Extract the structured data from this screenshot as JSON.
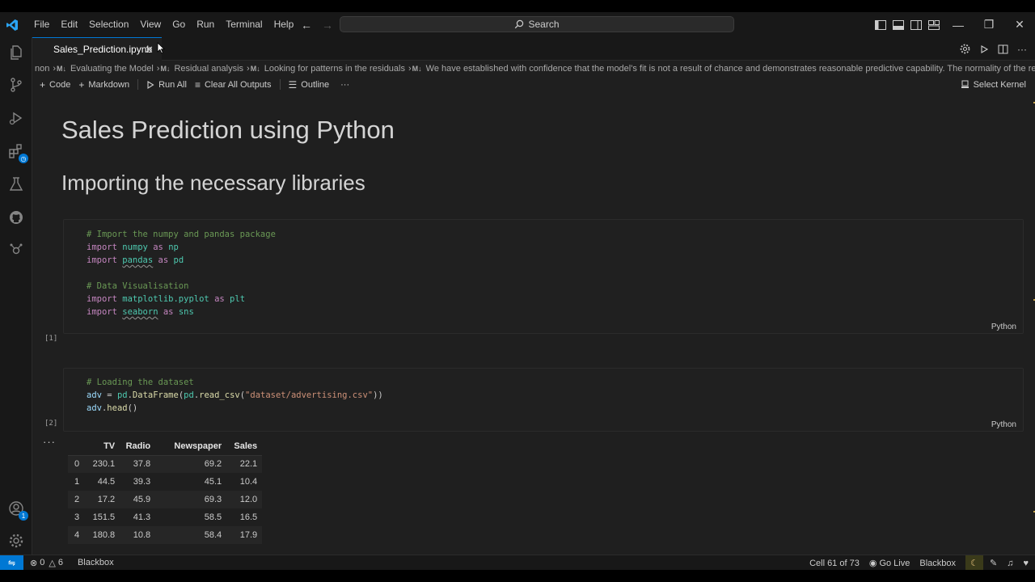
{
  "titlebar": {
    "menu": [
      "File",
      "Edit",
      "Selection",
      "View",
      "Go",
      "Run",
      "Terminal",
      "Help"
    ],
    "search_label": "Search"
  },
  "tab": {
    "filename": "Sales_Prediction.ipynb"
  },
  "breadcrumb": {
    "items": [
      "non",
      "Evaluating the Model",
      "Residual analysis",
      "Looking for patterns in the residuals",
      "We have established with confidence that the model's fit is not a result of chance and demonstrates reasonable predictive capability. The normality of the residu"
    ],
    "md_marker": "M↓"
  },
  "toolbar": {
    "code_label": "Code",
    "markdown_label": "Markdown",
    "run_all_label": "Run All",
    "clear_outputs_label": "Clear All Outputs",
    "outline_label": "Outline",
    "more_label": "···",
    "kernel_label": "Select Kernel"
  },
  "notebook": {
    "title": "Sales Prediction using Python",
    "subtitle": "Importing the necessary libraries",
    "cells": [
      {
        "exec_count": "[1]",
        "language": "Python",
        "lines": [
          "# Import the numpy and pandas package",
          "import numpy as np",
          "import pandas as pd",
          "",
          "# Data Visualisation",
          "import matplotlib.pyplot as plt",
          "import seaborn as sns"
        ]
      },
      {
        "exec_count": "[2]",
        "language": "Python",
        "lines": [
          "# Loading the dataset",
          "adv = pd.DataFrame(pd.read_csv(\"dataset/advertising.csv\"))",
          "adv.head()"
        ]
      }
    ],
    "output_more": "···",
    "table": {
      "columns": [
        "",
        "TV",
        "Radio",
        "Newspaper",
        "Sales"
      ],
      "rows": [
        [
          "0",
          "230.1",
          "37.8",
          "69.2",
          "22.1"
        ],
        [
          "1",
          "44.5",
          "39.3",
          "45.1",
          "10.4"
        ],
        [
          "2",
          "17.2",
          "45.9",
          "69.3",
          "12.0"
        ],
        [
          "3",
          "151.5",
          "41.3",
          "58.5",
          "16.5"
        ],
        [
          "4",
          "180.8",
          "10.8",
          "58.4",
          "17.9"
        ]
      ]
    }
  },
  "statusbar": {
    "errors": "0",
    "warnings": "6",
    "left_extension": "Blackbox",
    "cell_position": "Cell 61 of 73",
    "go_live": "Go Live",
    "right_extension": "Blackbox",
    "account_badge": "1"
  },
  "colors": {
    "accent": "#0078d4",
    "background": "#1f1f1f",
    "chrome": "#181818"
  }
}
